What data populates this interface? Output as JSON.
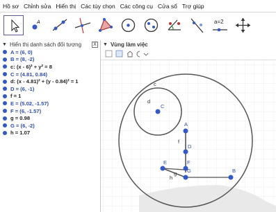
{
  "menu": [
    "Hồ sơ",
    "Chỉnh sửa",
    "Hiển thị",
    "Các tùy chọn",
    "Các công cụ",
    "Cửa sổ",
    "Trợ giúp"
  ],
  "toolbar": {
    "tools": [
      "move-tool",
      "point-tool",
      "line-tool",
      "perpendicular-line-tool",
      "polygon-tool",
      "circle-center-point-tool",
      "conic-tool",
      "angle-tool",
      "reflect-tool",
      "slider-tool",
      "move-graphics-view-tool"
    ],
    "slider_label": "a=2"
  },
  "algebra": {
    "title": "Hiển thị danh sách đối tượng",
    "close": "X",
    "items": [
      {
        "text": "A = (6, 0)",
        "color": "#2F4CB0"
      },
      {
        "text": "B = (8, -2)",
        "color": "#2F4CB0"
      },
      {
        "text": "c: (x - 6)² + y² = 8",
        "color": "#111111"
      },
      {
        "text": "C = (4.81, 0.84)",
        "color": "#2F4CB0"
      },
      {
        "text": "d: (x - 4.81)² + (y - 0.84)² = 1",
        "color": "#111111"
      },
      {
        "text": "D = (6, -1)",
        "color": "#2F4CB0"
      },
      {
        "text": "f = 1",
        "color": "#111111"
      },
      {
        "text": "E = (5.02, -1.57)",
        "color": "#2F4CB0"
      },
      {
        "text": "F = (6, -1.57)",
        "color": "#2F4CB0"
      },
      {
        "text": "g = 0.98",
        "color": "#111111"
      },
      {
        "text": "G = (6, -2)",
        "color": "#2F4CB0"
      },
      {
        "text": "h = 1.07",
        "color": "#111111"
      }
    ]
  },
  "graphics": {
    "title": "Vùng làm việc",
    "labels": {
      "c": "c",
      "d": "d",
      "C": "C",
      "A": "A",
      "D": "D",
      "F": "F",
      "E": "E",
      "B": "B",
      "f": "f",
      "g": "g",
      "h": "h",
      "G": "G"
    }
  }
}
